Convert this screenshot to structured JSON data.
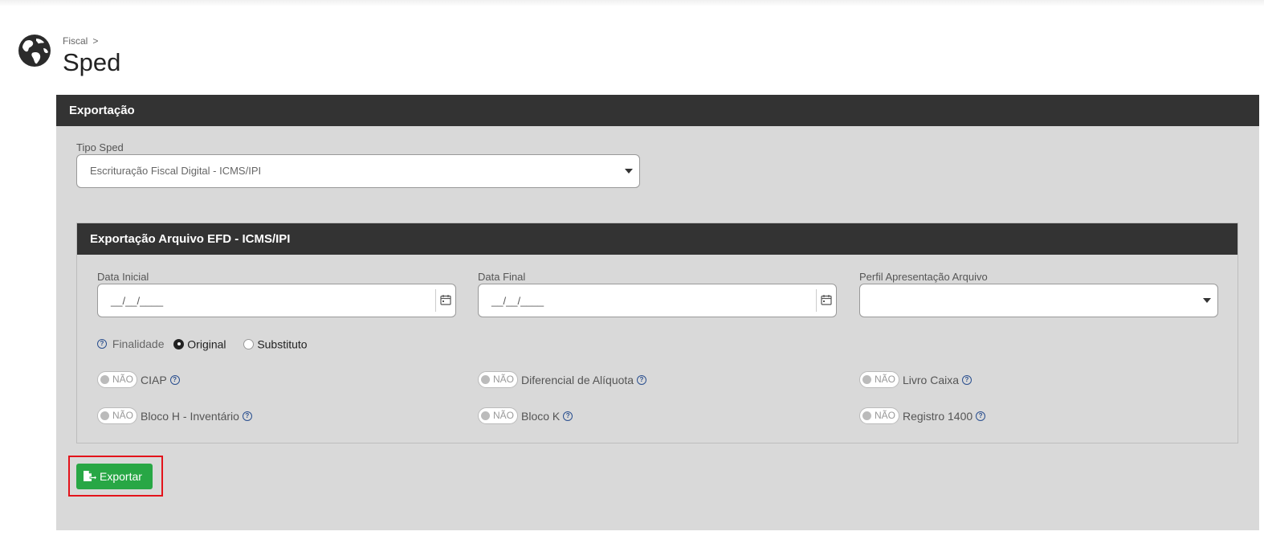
{
  "header": {
    "breadcrumb": "Fiscal",
    "breadcrumb_sep": ">",
    "title": "Sped"
  },
  "export_panel": {
    "title": "Exportação",
    "tipo_sped_label": "Tipo Sped",
    "tipo_sped_value": "Escrituração Fiscal Digital - ICMS/IPI"
  },
  "efd_panel": {
    "title": "Exportação Arquivo EFD - ICMS/IPI",
    "data_inicial_label": "Data Inicial",
    "data_inicial_value": "__/__/____",
    "data_final_label": "Data Final",
    "data_final_value": "__/__/____",
    "perfil_label": "Perfil Apresentação Arquivo",
    "perfil_value": "",
    "finalidade_label": "Finalidade",
    "finalidade_options": [
      "Original",
      "Substituto"
    ],
    "finalidade_selected": "Original",
    "toggle_off_text": "NÃO",
    "toggles": {
      "ciap": "CIAP",
      "diferencial": "Diferencial de Alíquota",
      "livro_caixa": "Livro Caixa",
      "bloco_h": "Bloco H - Inventário",
      "bloco_k": "Bloco K",
      "registro_1400": "Registro 1400"
    },
    "help_glyph": "?"
  },
  "actions": {
    "export_label": "Exportar"
  },
  "colors": {
    "accent_green": "#28a745",
    "panel_header": "#333333",
    "panel_bg": "#d9d9d9",
    "highlight_red": "#e3131b",
    "help_blue": "#2a4f8f"
  },
  "icons": {
    "globe": "globe-icon",
    "calendar": "calendar-icon",
    "export": "file-export-icon",
    "help": "help-circle-icon"
  }
}
